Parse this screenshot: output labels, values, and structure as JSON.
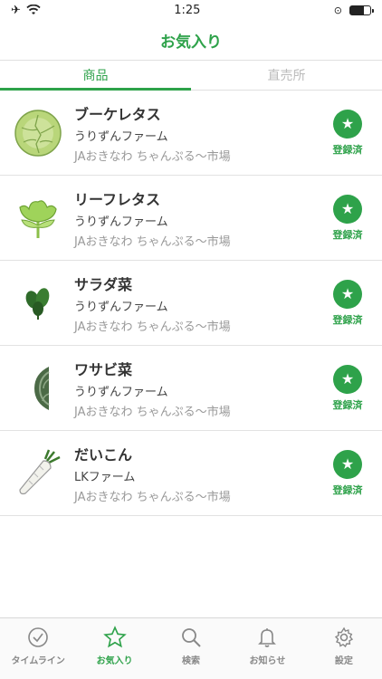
{
  "status": {
    "time": "1:25",
    "battery_level": 0.7
  },
  "nav": {
    "title": "お気入り"
  },
  "segments": [
    {
      "label": "商品",
      "active": true
    },
    {
      "label": "直売所",
      "active": false
    }
  ],
  "items": [
    {
      "name": "ブーケレタス",
      "farm": "うりずんファーム",
      "market": "JAおきなわ ちゃんぷる〜市場",
      "fav_label": "登録済",
      "icon": "butterhead-lettuce-icon"
    },
    {
      "name": "リーフレタス",
      "farm": "うりずんファーム",
      "market": "JAおきなわ ちゃんぷる〜市場",
      "fav_label": "登録済",
      "icon": "leaf-lettuce-icon"
    },
    {
      "name": "サラダ菜",
      "farm": "うりずんファーム",
      "market": "JAおきなわ ちゃんぷる〜市場",
      "fav_label": "登録済",
      "icon": "salad-greens-icon"
    },
    {
      "name": "ワサビ菜",
      "farm": "うりずんファーム",
      "market": "JAおきなわ ちゃんぷる〜市場",
      "fav_label": "登録済",
      "icon": "wasabi-greens-icon"
    },
    {
      "name": "だいこん",
      "farm": "LKファーム",
      "market": "JAおきなわ ちゃんぷる〜市場",
      "fav_label": "登録済",
      "icon": "daikon-icon"
    }
  ],
  "tabs": [
    {
      "label": "タイムライン",
      "icon": "check-circle-icon",
      "active": false
    },
    {
      "label": "お気入り",
      "icon": "star-icon",
      "active": true
    },
    {
      "label": "検索",
      "icon": "search-icon",
      "active": false
    },
    {
      "label": "お知らせ",
      "icon": "bell-icon",
      "active": false
    },
    {
      "label": "設定",
      "icon": "gear-icon",
      "active": false
    }
  ],
  "colors": {
    "accent": "#2ea24a",
    "muted": "#999999"
  }
}
